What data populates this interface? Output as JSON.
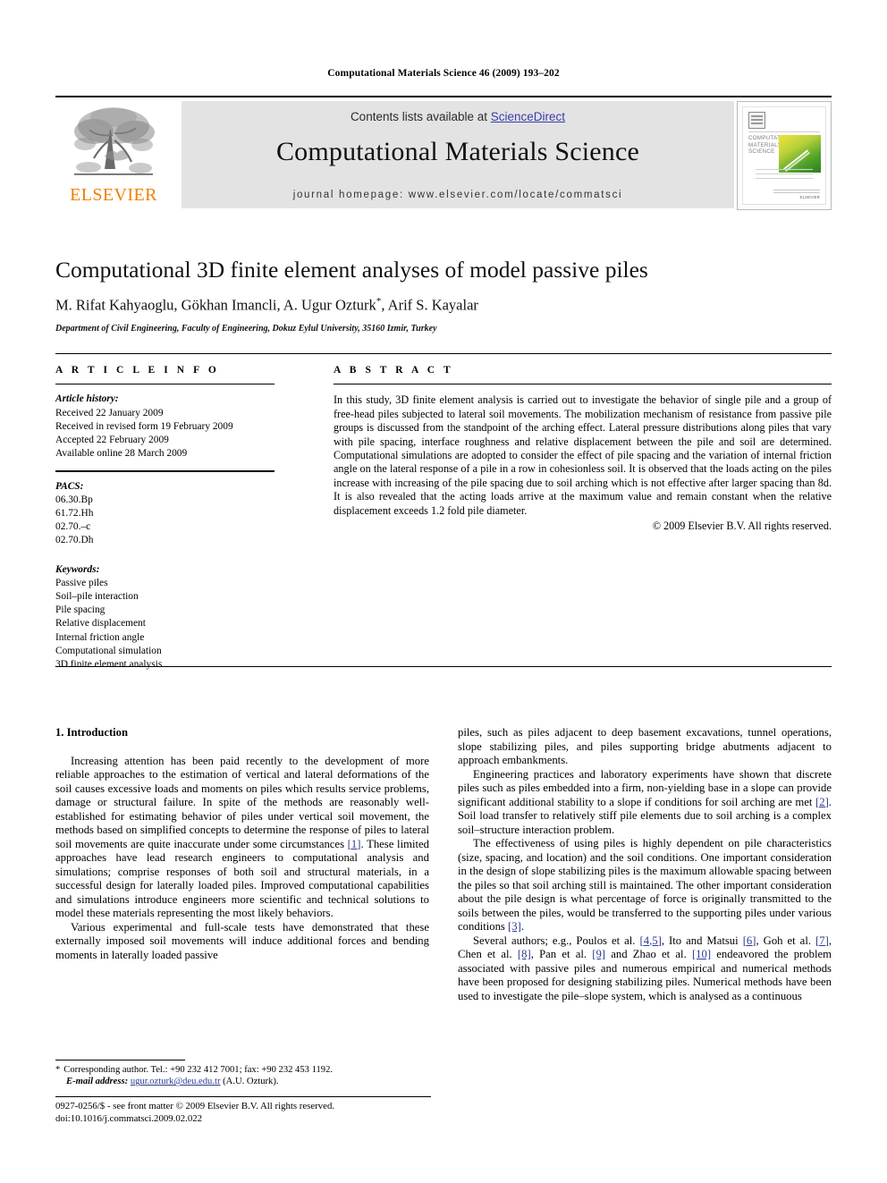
{
  "running_head": "Computational Materials Science 46 (2009) 193–202",
  "masthead": {
    "contents_prefix": "Contents lists available at ",
    "sciencedirect": "ScienceDirect",
    "journal_title": "Computational Materials Science",
    "homepage": "journal homepage: www.elsevier.com/locate/commatsci",
    "publisher_name": "ELSEVIER",
    "cover": {
      "title": "COMPUTATIONAL MATERIALS SCIENCE",
      "publisher_foot": "ELSEVIER"
    },
    "link_color": "#3b3bb0",
    "band_color": "#e3e3e3",
    "elsevier_orange": "#F08000"
  },
  "article": {
    "title": "Computational 3D finite element analyses of model passive piles",
    "authors": "M. Rifat Kahyaoglu, Gökhan Imancli, A. Ugur Ozturk",
    "authors_star": "*",
    "authors_tail": ", Arif S. Kayalar",
    "affiliation": "Department of Civil Engineering, Faculty of Engineering, Dokuz Eylul University, 35160 Izmir, Turkey"
  },
  "info": {
    "label": "A R T I C L E    I N F O",
    "history_header": "Article history:",
    "history": [
      "Received 22 January 2009",
      "Received in revised form 19 February 2009",
      "Accepted 22 February 2009",
      "Available online 28 March 2009"
    ],
    "pacs_header": "PACS:",
    "pacs": [
      "06.30.Bp",
      "61.72.Hh",
      "02.70.–c",
      "02.70.Dh"
    ],
    "keywords_header": "Keywords:",
    "keywords": [
      "Passive piles",
      "Soil–pile interaction",
      "Pile spacing",
      "Relative displacement",
      "Internal friction angle",
      "Computational simulation",
      "3D finite element analysis"
    ]
  },
  "abstract": {
    "label": "A B S T R A C T",
    "text": "In this study, 3D finite element analysis is carried out to investigate the behavior of single pile and a group of free-head piles subjected to lateral soil movements. The mobilization mechanism of resistance from passive pile groups is discussed from the standpoint of the arching effect. Lateral pressure distributions along piles that vary with pile spacing, interface roughness and relative displacement between the pile and soil are determined. Computational simulations are adopted to consider the effect of pile spacing and the variation of internal friction angle on the lateral response of a pile in a row in cohesionless soil. It is observed that the loads acting on the piles increase with increasing of the pile spacing due to soil arching which is not effective after larger spacing than 8d. It is also revealed that the acting loads arrive at the maximum value and remain constant when the relative displacement exceeds 1.2 fold pile diameter.",
    "copyright": "© 2009 Elsevier B.V. All rights reserved."
  },
  "body": {
    "section_heading": "1. Introduction",
    "left_paragraphs": [
      "Increasing attention has been paid recently to the development of more reliable approaches to the estimation of vertical and lateral deformations of the soil causes excessive loads and moments on piles which results service problems, damage or structural failure. In spite of the methods are reasonably well-established for estimating behavior of piles under vertical soil movement, the methods based on simplified concepts to determine the response of piles to lateral soil movements are quite inaccurate under some circumstances [1]. These limited approaches have lead research engineers to computational analysis and simulations; comprise responses of both soil and structural materials, in a successful design for laterally loaded piles. Improved computational capabilities and simulations introduce engineers more scientific and technical solutions to model these materials representing the most likely behaviors.",
      "Various experimental and full-scale tests have demonstrated that these externally imposed soil movements will induce additional forces and bending moments in laterally loaded passive"
    ],
    "right_paragraphs": [
      "piles, such as piles adjacent to deep basement excavations, tunnel operations, slope stabilizing piles, and piles supporting bridge abutments adjacent to approach embankments.",
      "Engineering practices and laboratory experiments have shown that discrete piles such as piles embedded into a firm, non-yielding base in a slope can provide significant additional stability to a slope if conditions for soil arching are met [2]. Soil load transfer to relatively stiff pile elements due to soil arching is a complex soil–structure interaction problem.",
      "The effectiveness of using piles is highly dependent on pile characteristics (size, spacing, and location) and the soil conditions. One important consideration in the design of slope stabilizing piles is the maximum allowable spacing between the piles so that soil arching still is maintained. The other important consideration about the pile design is what percentage of force is originally transmitted to the soils between the piles, would be transferred to the supporting piles under various conditions [3].",
      "Several authors; e.g., Poulos et al. [4,5], Ito and Matsui [6], Goh et al. [7], Chen et al. [8], Pan et al. [9] and Zhao et al. [10] endeavored the problem associated with passive piles and numerous empirical and numerical methods have been proposed for designing stabilizing piles. Numerical methods have been used to investigate the pile–slope system, which is analysed as a continuous"
    ],
    "citation_color": "#2b3a8f"
  },
  "footnote": {
    "star": "*",
    "corresponding": "Corresponding author. Tel.: +90 232 412 7001; fax: +90 232 453 1192.",
    "email_label": "E-mail address:",
    "email": "ugur.ozturk@deu.edu.tr",
    "email_owner": "(A.U. Ozturk)."
  },
  "footer": {
    "issn_line": "0927-0256/$ - see front matter © 2009 Elsevier B.V. All rights reserved.",
    "doi_line": "doi:10.1016/j.commatsci.2009.02.022"
  }
}
